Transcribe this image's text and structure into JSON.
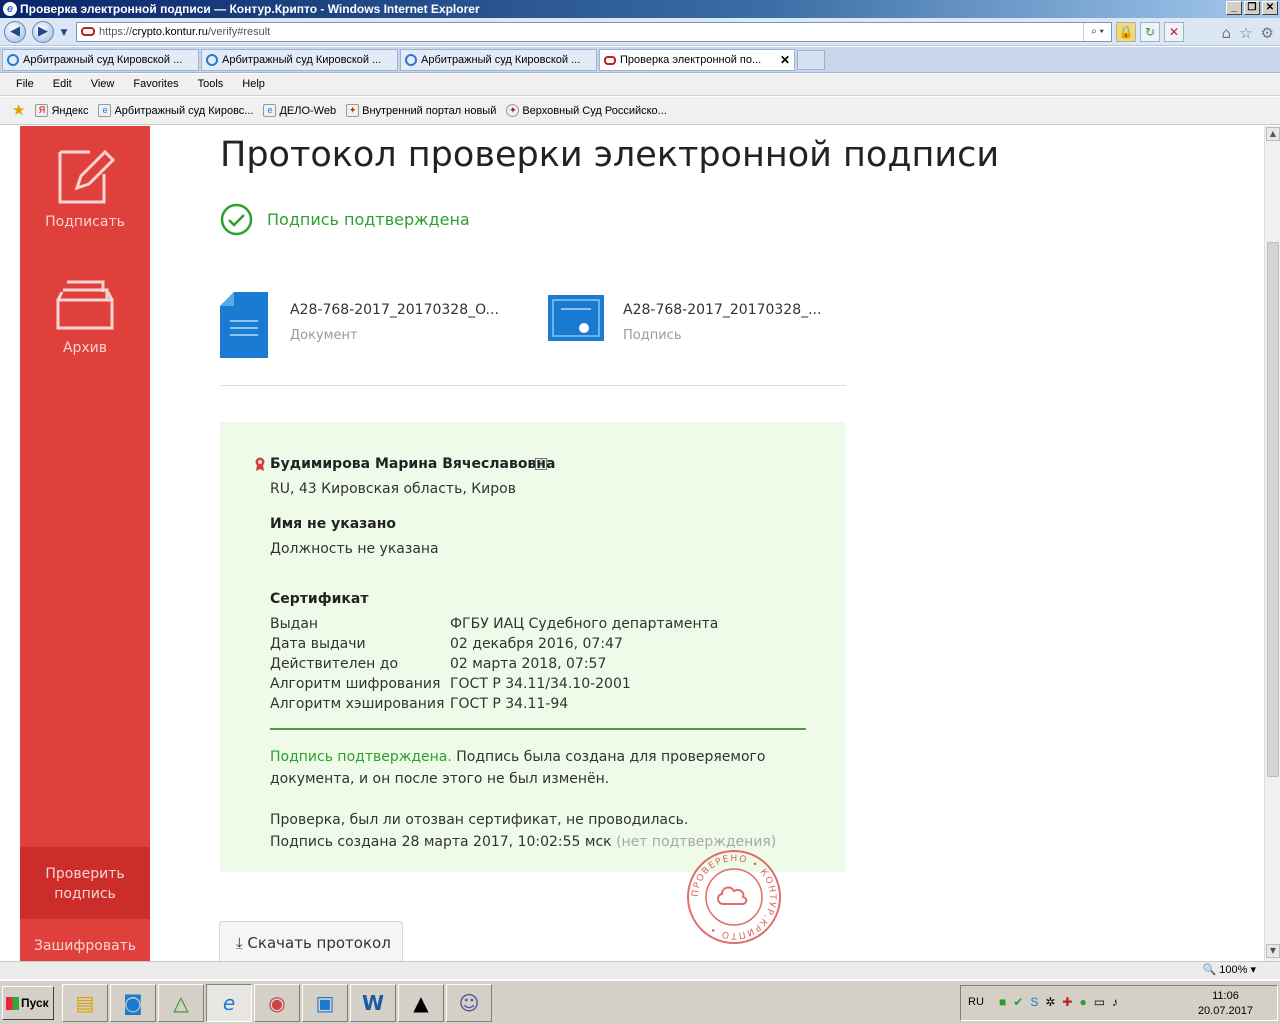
{
  "window": {
    "title": "Проверка электронной подписи — Контур.Крипто - Windows Internet Explorer",
    "minimize": "_",
    "restore": "❐",
    "close": "✕"
  },
  "address": {
    "url_prefix": "https://",
    "host": "crypto.kontur.ru",
    "path": "/verify#result"
  },
  "tabs": [
    {
      "label": "Арбитражный суд Кировской ..."
    },
    {
      "label": "Арбитражный суд Кировской ..."
    },
    {
      "label": "Арбитражный суд Кировской ..."
    },
    {
      "label": "Проверка электронной по...",
      "active": true
    }
  ],
  "menu": [
    "File",
    "Edit",
    "View",
    "Favorites",
    "Tools",
    "Help"
  ],
  "favorites": [
    {
      "label": "Яндекс"
    },
    {
      "label": "Арбитражный суд Кировс..."
    },
    {
      "label": "ДЕЛО-Web"
    },
    {
      "label": "Внутренний портал новый"
    },
    {
      "label": "Верховный Суд Российско..."
    }
  ],
  "sidebar": {
    "sign": "Подписать",
    "archive": "Архив",
    "verify_line1": "Проверить",
    "verify_line2": "подпись",
    "encrypt": "Зашифровать"
  },
  "page": {
    "title": "Протокол проверки электронной подписи",
    "status": "Подпись подтверждена",
    "document": {
      "name": "A28-768-2017_20170328_O...",
      "type": "Документ"
    },
    "signature": {
      "name": "A28-768-2017_20170328_...",
      "type": "Подпись"
    }
  },
  "result": {
    "signer": "Будимирова Марина Вячеславовна",
    "location": "RU, 43 Кировская область, Киров",
    "name_label": "Имя не указано",
    "position": "Должность не указана",
    "cert_heading": "Сертификат",
    "cert_rows": [
      {
        "key": "Выдан",
        "value": "ФГБУ ИАЦ Судебного департамента"
      },
      {
        "key": "Дата выдачи",
        "value": "02 декабря 2016, 07:47"
      },
      {
        "key": "Действителен до",
        "value": "02 марта 2018, 07:57"
      },
      {
        "key": "Алгоритм шифрования",
        "value": "ГОСТ Р 34.11/34.10-2001"
      },
      {
        "key": "Алгоритм хэширования",
        "value": "ГОСТ Р 34.11-94"
      }
    ],
    "confirmed": "Подпись подтверждена.",
    "confirmed_rest_1": " Подпись была создана для проверяемого",
    "confirmed_rest_2": "документа, и он после этого не был изменён.",
    "revocation": "Проверка, был ли отозван сертификат, не проводилась.",
    "created": "Подпись создана 28 марта 2017, 10:02:55 мск",
    "created_note": "(нет подтверждения)"
  },
  "stamp": {
    "text": "ПРОВЕРЕНО • КОНТУР.КРИПТО •"
  },
  "download_button": "Скачать протокол",
  "statusbar": {
    "zoom": "100%"
  },
  "taskbar": {
    "start": "Пуск",
    "lang": "RU",
    "time": "11:06",
    "date": "20.07.2017"
  },
  "colors": {
    "sidebar": "#e0403c",
    "sidebar_active": "#cc2d2a",
    "success": "#2ea02e",
    "panel_bg": "#eefbe8",
    "doc_blue": "#1b7ad1"
  }
}
